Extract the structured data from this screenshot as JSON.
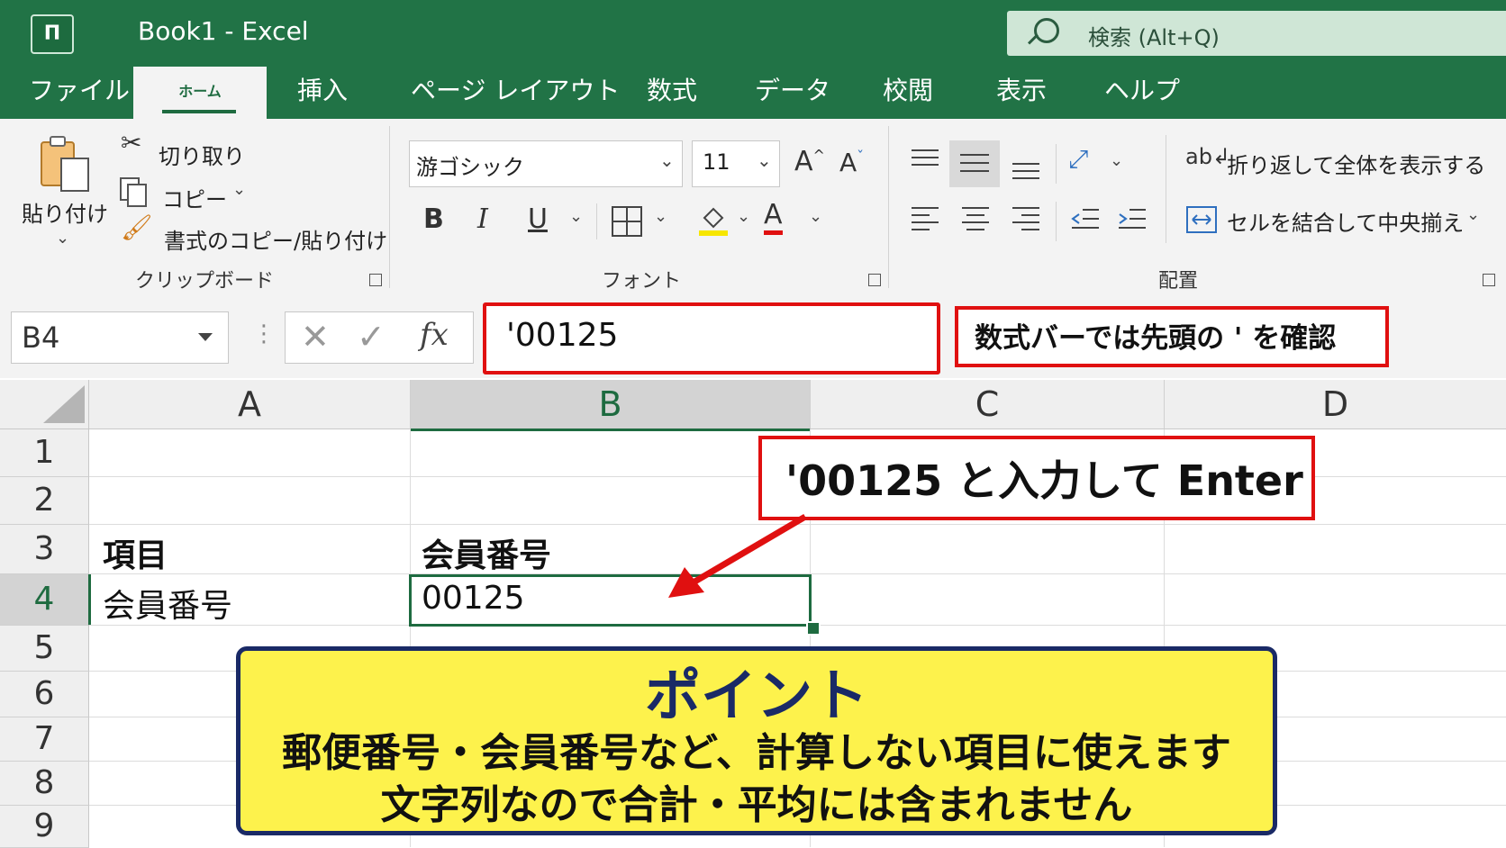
{
  "window": {
    "title": "Book1  -  Excel",
    "app_logo": "Π"
  },
  "search": {
    "placeholder": "検索 (Alt+Q)"
  },
  "tabs": [
    {
      "label": "ファイル"
    },
    {
      "label": "ホーム"
    },
    {
      "label": "挿入"
    },
    {
      "label": "ページ レイアウト"
    },
    {
      "label": "数式"
    },
    {
      "label": "データ"
    },
    {
      "label": "校閲"
    },
    {
      "label": "表示"
    },
    {
      "label": "ヘルプ"
    }
  ],
  "ribbon": {
    "clipboard": {
      "paste": "貼り付け",
      "cut": "切り取り",
      "copy": "コピー",
      "format_painter": "書式のコピー/貼り付け",
      "group_label": "クリップボード"
    },
    "font": {
      "font_name": "游ゴシック",
      "font_size": "11",
      "group_label": "フォント",
      "bold": "B",
      "italic": "I",
      "underline": "U",
      "grow": "A",
      "shrink": "A",
      "font_color": "A"
    },
    "alignment": {
      "wrap_text": "折り返して全体を表示する",
      "merge_center": "セルを結合して中央揃え",
      "group_label": "配置"
    }
  },
  "formula_bar": {
    "name_box": "B4",
    "fx": "fx",
    "value": "'00125",
    "note": "数式バーでは先頭の ' を確認"
  },
  "columns": [
    "A",
    "B",
    "C",
    "D"
  ],
  "rows": [
    "1",
    "2",
    "3",
    "4",
    "5",
    "6",
    "7",
    "8",
    "9"
  ],
  "cells": {
    "A3": "項目",
    "B3": "会員番号",
    "A4": "会員番号",
    "B4": "00125"
  },
  "annotations": {
    "input_note": "'00125 と入力して Enter",
    "point_title": "ポイント",
    "point_line1": "郵便番号・会員番号など、計算しない項目に使えます",
    "point_line2": "文字列なので合計・平均には含まれません"
  },
  "colors": {
    "excel_green": "#217346",
    "highlight_red": "#e01010",
    "note_yellow": "#fdf24c",
    "note_navy": "#1a2a66"
  }
}
